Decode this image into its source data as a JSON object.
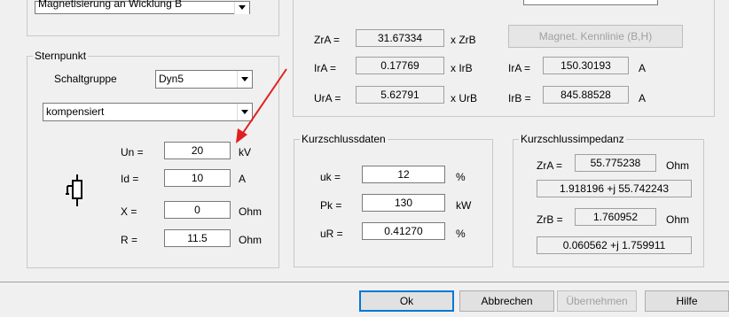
{
  "top_combo": {
    "value": "Magnetisierung an Wicklung B"
  },
  "sternpunkt": {
    "title": "Sternpunkt",
    "schaltgruppe_label": "Schaltgruppe",
    "schaltgruppe_value": "Dyn5",
    "mode_value": "kompensiert",
    "fields": [
      {
        "label": "Un =",
        "value": "20",
        "unit": "kV"
      },
      {
        "label": "Id =",
        "value": "10",
        "unit": "A"
      },
      {
        "label": "X =",
        "value": "0",
        "unit": "Ohm"
      },
      {
        "label": "R =",
        "value": "11.5",
        "unit": "Ohm"
      }
    ]
  },
  "magnet": {
    "zrA_label": "ZrA =",
    "zrA_value": "31.67334",
    "zrA_unit": "x ZrB",
    "irA_label": "IrA =",
    "irA_value": "0.17769",
    "irA_unit": "x IrB",
    "urA_label": "UrA =",
    "urA_value": "5.62791",
    "urA_unit": "x UrB",
    "kennlinie_button": "Magnet. Kennlinie (B,H)",
    "IrA_label": "IrA =",
    "IrA_value": "150.30193",
    "IrA_unit": "A",
    "IrB_label": "IrB =",
    "IrB_value": "845.88528",
    "IrB_unit": "A"
  },
  "kurzschlussdaten": {
    "title": "Kurzschlussdaten",
    "fields": [
      {
        "label": "uk =",
        "value": "12",
        "unit": "%"
      },
      {
        "label": "Pk =",
        "value": "130",
        "unit": "kW"
      },
      {
        "label": "uR =",
        "value": "0.41270",
        "unit": "%"
      }
    ]
  },
  "kurzschlussimpedanz": {
    "title": "Kurzschlussimpedanz",
    "zrA_label": "ZrA =",
    "zrA_value": "55.775238",
    "zrA_unit": "Ohm",
    "zrA_complex": "1.918196 +j 55.742243",
    "zrB_label": "ZrB =",
    "zrB_value": "1.760952",
    "zrB_unit": "Ohm",
    "zrB_complex": "0.060562 +j 1.759911"
  },
  "buttons": {
    "ok": "Ok",
    "cancel": "Abbrechen",
    "apply": "Übernehmen",
    "help": "Hilfe"
  },
  "colors": {
    "arrow": "#e02020",
    "focus": "#0078d7"
  },
  "icons": {
    "grounding": "transformer-grounding-icon",
    "dropdown": "chevron-down-icon",
    "annotation": "red-arrow"
  }
}
